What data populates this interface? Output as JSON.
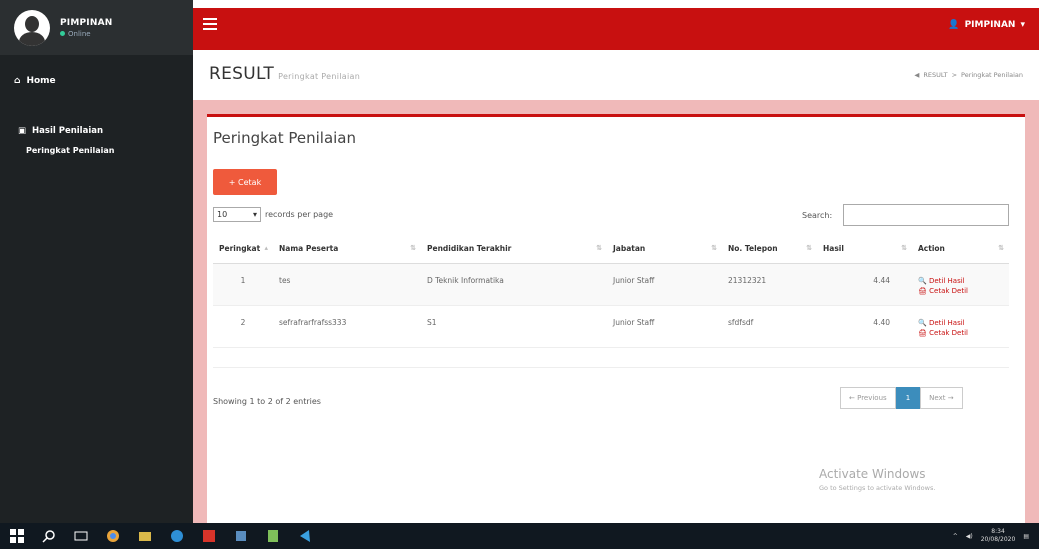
{
  "sidebar": {
    "user_name": "PIMPINAN",
    "user_status": "Online",
    "home_label": "Home",
    "group_label": "Hasil Penilaian",
    "sub_label": "Peringkat Penilaian"
  },
  "topbar": {
    "user_label": "PIMPINAN"
  },
  "header": {
    "title": "RESULT",
    "subtitle": "Peringkat Penilaian",
    "breadcrumb": [
      "RESULT",
      "Peringkat Penilaian"
    ]
  },
  "box": {
    "title": "Peringkat Penilaian",
    "print_button": "+ Cetak",
    "length_value": "10",
    "length_label": "records per page",
    "search_label": "Search:",
    "columns": [
      "Peringkat",
      "Nama Peserta",
      "Pendidikan Terakhir",
      "Jabatan",
      "No. Telepon",
      "Hasil",
      "Action"
    ],
    "rows": [
      [
        "1",
        "tes",
        "D Teknik Informatika",
        "Junior Staff",
        "21312321",
        "4.44"
      ],
      [
        "2",
        "sefrafrarfrafss333",
        "S1",
        "Junior Staff",
        "sfdfsdf",
        "4.40"
      ]
    ],
    "action_detail": "Detil Hasil",
    "action_print": "Cetak Detil",
    "info": "Showing 1 to 2 of 2 entries",
    "pager": {
      "prev": "← Previous",
      "page": "1",
      "next": "Next →"
    }
  },
  "watermark": {
    "line1": "Activate Windows",
    "line2": "Go to Settings to activate Windows."
  },
  "taskbar": {
    "time": "8:34",
    "date": "20/08/2020"
  },
  "colors": {
    "brand_red": "#c81010",
    "print_orange": "#ef5a3c",
    "active_page": "#3c8dbc"
  }
}
